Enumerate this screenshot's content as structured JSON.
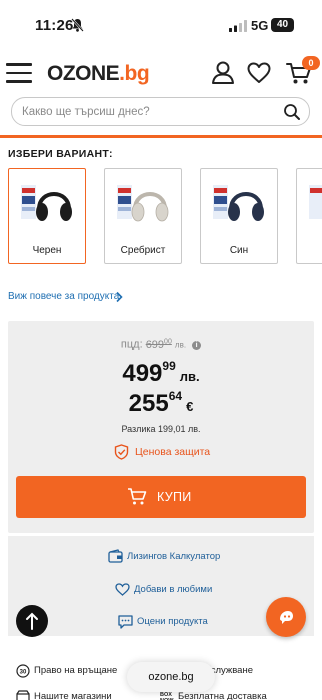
{
  "status_bar": {
    "time": "11:26",
    "network": "5G",
    "battery": "40"
  },
  "header": {
    "logo_main": "OZONE",
    "logo_accent": ".bg",
    "cart_count": "0"
  },
  "search": {
    "placeholder": "Какво ще търсиш днес?"
  },
  "variants": {
    "title": "ИЗБЕРИ ВАРИАНТ:",
    "items": [
      {
        "label": "Черен",
        "color": "#1c1c1c",
        "selected": true
      },
      {
        "label": "Сребрист",
        "color": "#d8d4cc",
        "selected": false
      },
      {
        "label": "Син",
        "color": "#27324a",
        "selected": false
      },
      {
        "label": "",
        "color": "#cccccc",
        "selected": false
      }
    ]
  },
  "more_link": "Виж повече за продукта",
  "price": {
    "old_prefix": "пцд:",
    "old_whole": "699",
    "old_fraction": "00",
    "old_currency": "лв.",
    "bgn_whole": "499",
    "bgn_fraction": "99",
    "bgn_currency": "лв.",
    "eur_whole": "255",
    "eur_fraction": "64",
    "eur_currency": "€",
    "difference": "Разлика 199,01 лв.",
    "protection": "Ценова защита",
    "buy": "КУПИ"
  },
  "actions": {
    "leasing": "Лизингов Калкулатор",
    "favorites": "Добави в любими",
    "review": "Оцени продукта"
  },
  "features": {
    "return": "Право на връщане",
    "service": "Обслужване",
    "stores": "Нашите магазини",
    "delivery": "Безплатна доставка"
  },
  "browser": {
    "url": "ozone.bg"
  },
  "colors": {
    "accent": "#f26522",
    "link": "#1f6fb2"
  }
}
